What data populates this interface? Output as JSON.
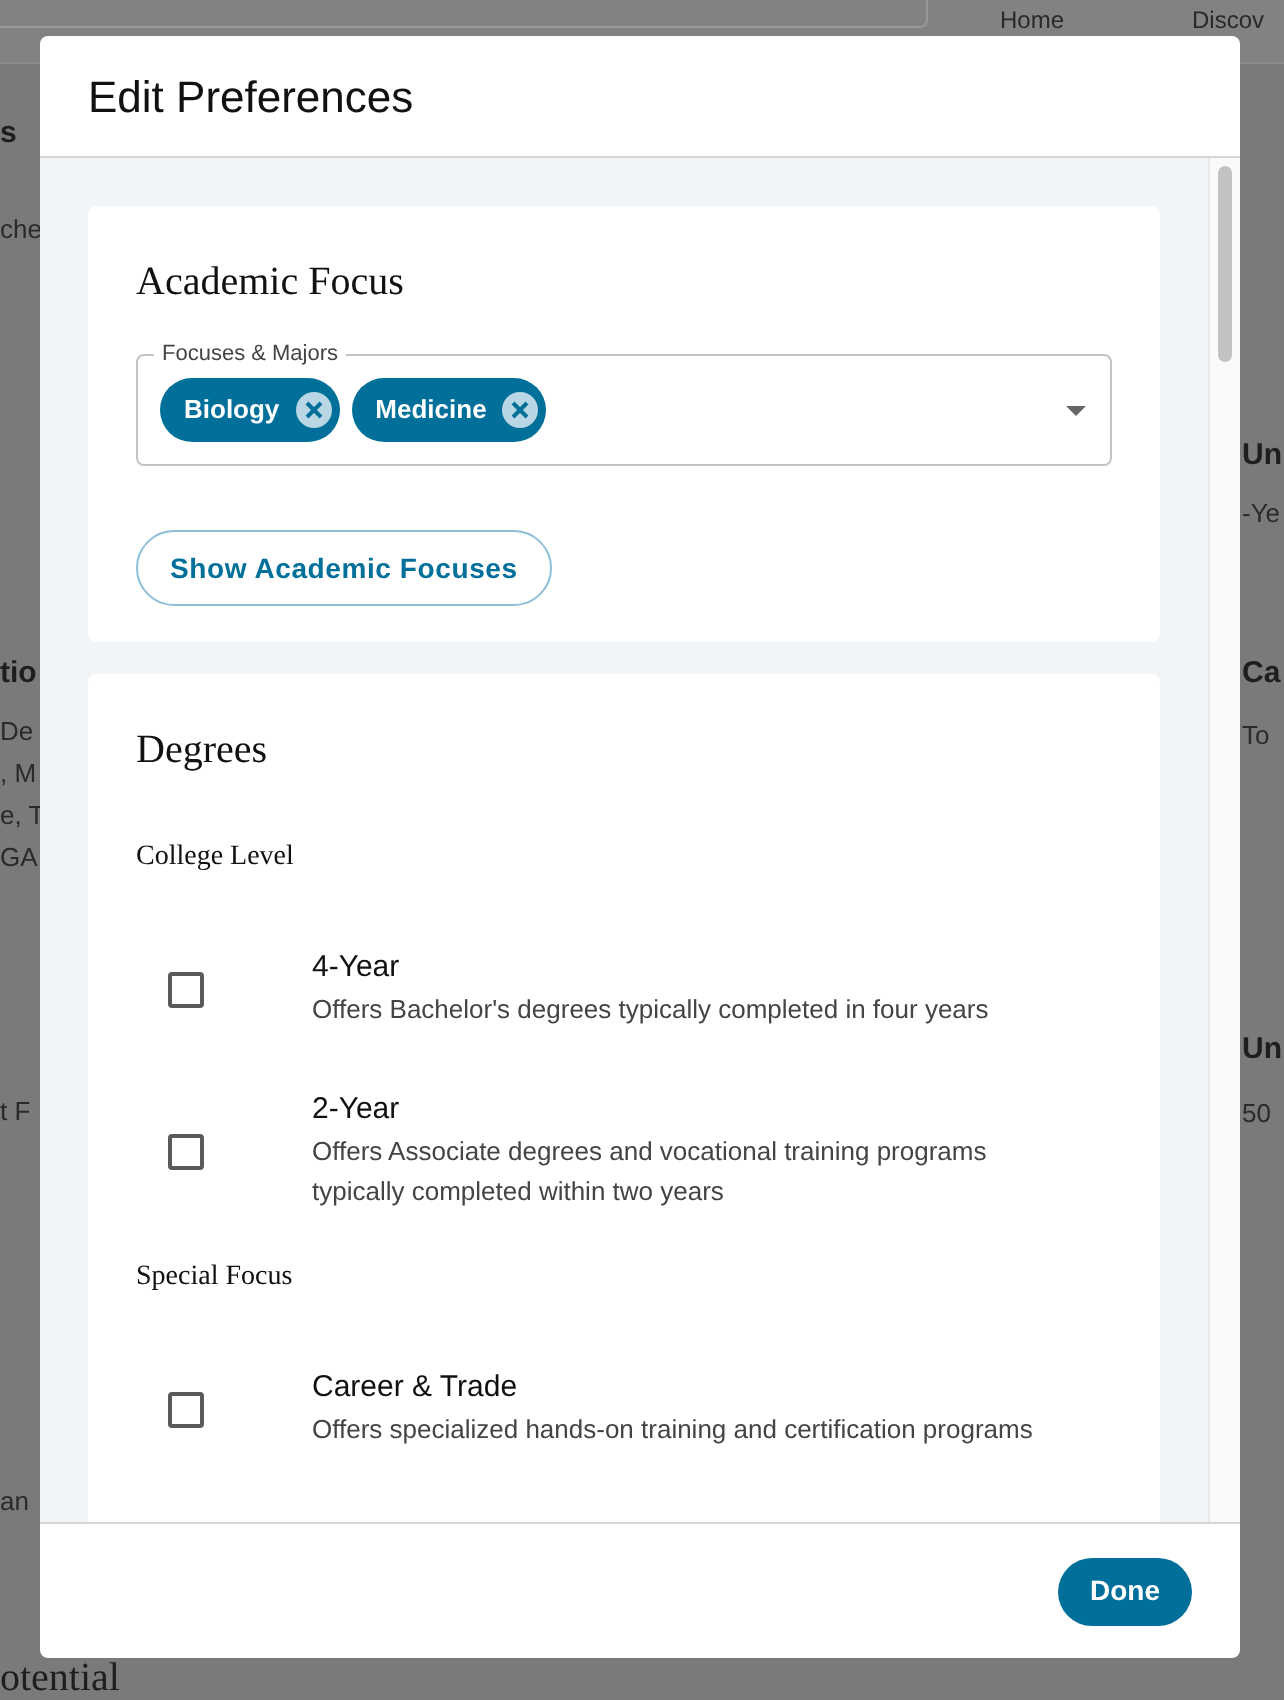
{
  "background": {
    "nav": [
      {
        "label": "Home"
      },
      {
        "label": "Discov"
      }
    ],
    "left_fragments": [
      {
        "text": "s",
        "kind": "heading"
      },
      {
        "text": "che",
        "kind": "text"
      },
      {
        "text": "tio",
        "kind": "heading"
      },
      {
        "text": "De",
        "kind": "text"
      },
      {
        "text": ", M",
        "kind": "text"
      },
      {
        "text": "e, T",
        "kind": "text"
      },
      {
        "text": "GA",
        "kind": "text"
      },
      {
        "text": "t F",
        "kind": "text"
      },
      {
        "text": "an",
        "kind": "text"
      }
    ],
    "right_fragments": [
      {
        "text": "Un",
        "kind": "heading"
      },
      {
        "text": "-Ye",
        "kind": "text"
      },
      {
        "text": "Ca",
        "kind": "heading"
      },
      {
        "text": "To",
        "kind": "text"
      },
      {
        "text": "Un",
        "kind": "heading"
      },
      {
        "text": "50",
        "kind": "text"
      }
    ],
    "bottom_fragment": "otential"
  },
  "dialog": {
    "title": "Edit Preferences",
    "academic_focus": {
      "title": "Academic Focus",
      "field": {
        "label": "Focuses & Majors",
        "chips": [
          "Biology",
          "Medicine"
        ]
      },
      "button": "Show Academic Focuses"
    },
    "degrees": {
      "title": "Degrees",
      "groups": [
        {
          "title": "College Level",
          "options": [
            {
              "label": "4-Year",
              "description": "Offers Bachelor's degrees typically completed in four years",
              "checked": false
            },
            {
              "label": "2-Year",
              "description": "Offers Associate degrees and vocational training programs typically completed within two years",
              "checked": false
            }
          ]
        },
        {
          "title": "Special Focus",
          "options": [
            {
              "label": "Career & Trade",
              "description": "Offers specialized hands-on training and certification programs",
              "checked": false
            }
          ]
        }
      ]
    },
    "done_button": "Done"
  }
}
